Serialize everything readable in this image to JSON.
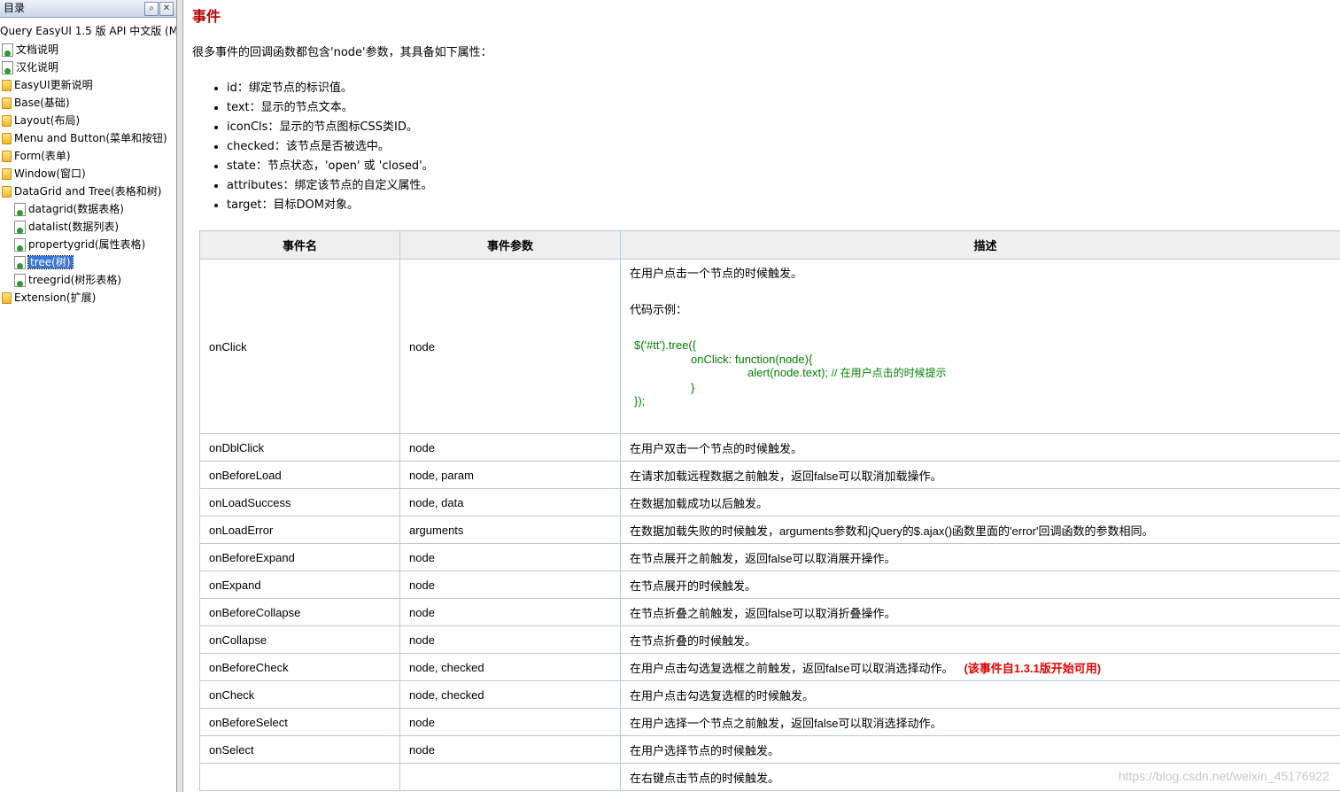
{
  "sidebar": {
    "header": "目录",
    "title": "Query EasyUI 1.5 版 API 中文版 (M",
    "items": [
      {
        "label": "文档说明",
        "type": "page"
      },
      {
        "label": "汉化说明",
        "type": "page"
      },
      {
        "label": "EasyUI更新说明",
        "type": "folder"
      },
      {
        "label": "Base(基础)",
        "type": "folder"
      },
      {
        "label": "Layout(布局)",
        "type": "folder"
      },
      {
        "label": "Menu and Button(菜单和按钮)",
        "type": "folder"
      },
      {
        "label": "Form(表单)",
        "type": "folder"
      },
      {
        "label": "Window(窗口)",
        "type": "folder"
      },
      {
        "label": "DataGrid and Tree(表格和树)",
        "type": "folder"
      },
      {
        "label": "datagrid(数据表格)",
        "type": "page"
      },
      {
        "label": "datalist(数据列表)",
        "type": "page"
      },
      {
        "label": "propertygrid(属性表格)",
        "type": "page"
      },
      {
        "label": "tree(树)",
        "type": "page",
        "selected": true
      },
      {
        "label": "treegrid(树形表格)",
        "type": "page"
      },
      {
        "label": "Extension(扩展)",
        "type": "folder"
      }
    ]
  },
  "content": {
    "title": "事件",
    "intro": "很多事件的回调函数都包含'node'参数，其具备如下属性：",
    "props": [
      "id：绑定节点的标识值。",
      "text：显示的节点文本。",
      "iconCls：显示的节点图标CSS类ID。",
      "checked：该节点是否被选中。",
      "state：节点状态，'open' 或 'closed'。",
      "attributes：绑定该节点的自定义属性。",
      "target：目标DOM对象。"
    ],
    "table": {
      "headers": [
        "事件名",
        "事件参数",
        "描述"
      ],
      "onclick": {
        "name": "onClick",
        "param": "node",
        "desc": "在用户点击一个节点的时候触发。",
        "code_label": "代码示例：",
        "code_lines": [
          "$('#tt').tree({",
          "onClick: function(node){",
          "alert(node.text);",
          "// 在用户点击的时候提示",
          "}",
          "});"
        ]
      },
      "rows": [
        {
          "name": "onDblClick",
          "param": "node",
          "desc": "在用户双击一个节点的时候触发。"
        },
        {
          "name": "onBeforeLoad",
          "param": "node, param",
          "desc": "在请求加载远程数据之前触发，返回false可以取消加载操作。"
        },
        {
          "name": "onLoadSuccess",
          "param": "node, data",
          "desc": "在数据加载成功以后触发。"
        },
        {
          "name": "onLoadError",
          "param": "arguments",
          "desc": "在数据加载失败的时候触发，arguments参数和jQuery的$.ajax()函数里面的'error'回调函数的参数相同。"
        },
        {
          "name": "onBeforeExpand",
          "param": "node",
          "desc": "在节点展开之前触发，返回false可以取消展开操作。"
        },
        {
          "name": "onExpand",
          "param": "node",
          "desc": "在节点展开的时候触发。"
        },
        {
          "name": "onBeforeCollapse",
          "param": "node",
          "desc": "在节点折叠之前触发，返回false可以取消折叠操作。"
        },
        {
          "name": "onCollapse",
          "param": "node",
          "desc": "在节点折叠的时候触发。"
        },
        {
          "name": "onBeforeCheck",
          "param": "node, checked",
          "desc": "在用户点击勾选复选框之前触发，返回false可以取消选择动作。",
          "note": "(该事件自1.3.1版开始可用)"
        },
        {
          "name": "onCheck",
          "param": "node, checked",
          "desc": "在用户点击勾选复选框的时候触发。"
        },
        {
          "name": "onBeforeSelect",
          "param": "node",
          "desc": "在用户选择一个节点之前触发，返回false可以取消选择动作。"
        },
        {
          "name": "onSelect",
          "param": "node",
          "desc": "在用户选择节点的时候触发。"
        },
        {
          "name": "",
          "param": "",
          "desc": "在右键点击节点的时候触发。"
        }
      ]
    },
    "watermark": "https://blog.csdn.net/weixin_45176922"
  }
}
